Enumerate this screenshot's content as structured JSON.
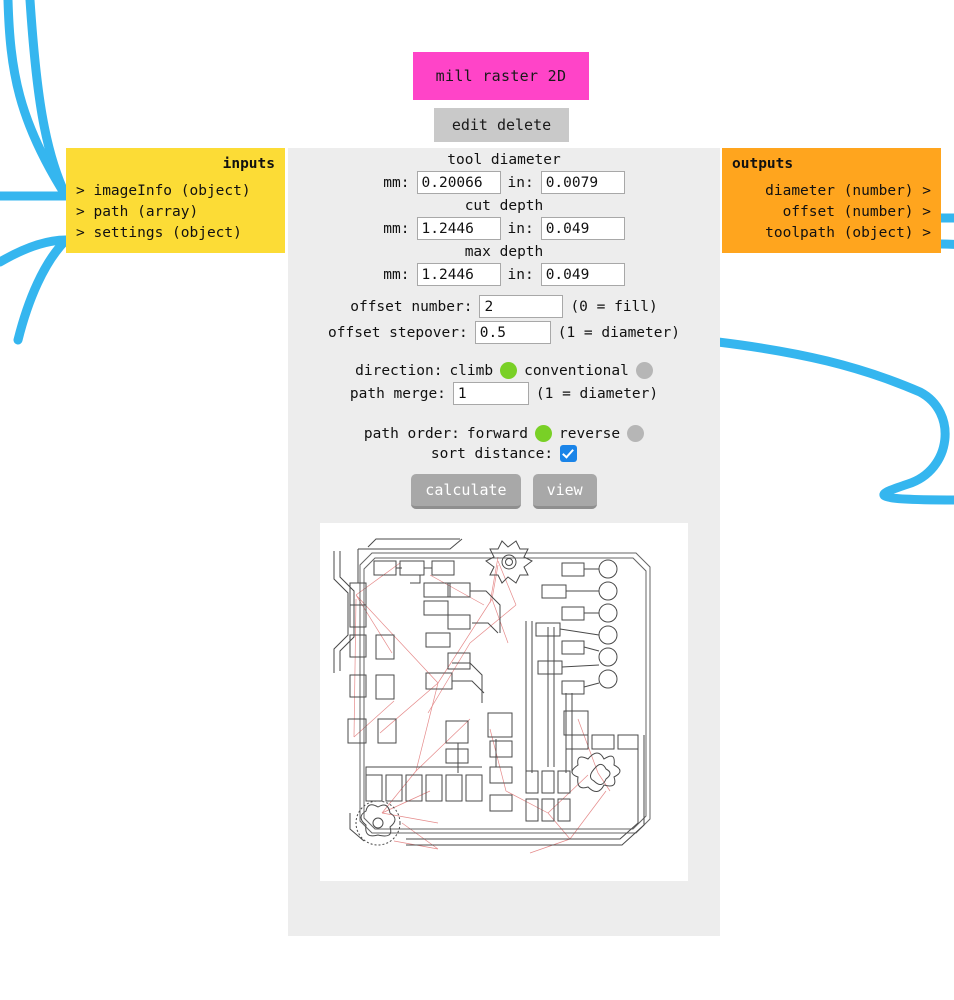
{
  "node": {
    "title": "mill raster 2D",
    "title_color": "#ff44c8",
    "menu": {
      "edit": "edit",
      "delete": "delete"
    }
  },
  "inputs": {
    "heading": "inputs",
    "panel_color": "#fcdc36",
    "items": [
      {
        "arrow": ">",
        "label": "imageInfo (object)"
      },
      {
        "arrow": ">",
        "label": "path (array)"
      },
      {
        "arrow": ">",
        "label": "settings (object)"
      }
    ]
  },
  "outputs": {
    "heading": "outputs",
    "panel_color": "#ffa51e",
    "items": [
      {
        "label": "diameter (number)",
        "arrow": ">"
      },
      {
        "label": "offset (number)",
        "arrow": ">"
      },
      {
        "label": "toolpath (object)",
        "arrow": ">"
      }
    ]
  },
  "form": {
    "tool_diameter": {
      "group_label": "tool diameter",
      "mm_label": "mm:",
      "mm_value": "0.20066",
      "in_label": "in:",
      "in_value": "0.0079"
    },
    "cut_depth": {
      "group_label": "cut depth",
      "mm_label": "mm:",
      "mm_value": "1.2446",
      "in_label": "in:",
      "in_value": "0.049"
    },
    "max_depth": {
      "group_label": "max depth",
      "mm_label": "mm:",
      "mm_value": "1.2446",
      "in_label": "in:",
      "in_value": "0.049"
    },
    "offset_number": {
      "label": "offset number:",
      "value": "2",
      "hint": "(0 = fill)"
    },
    "offset_stepover": {
      "label": "offset stepover:",
      "value": "0.5",
      "hint": "(1 = diameter)"
    },
    "direction": {
      "label": "direction:",
      "option_climb": "climb",
      "option_conventional": "conventional",
      "selected": "climb"
    },
    "path_merge": {
      "label": "path merge:",
      "value": "1",
      "hint": "(1 = diameter)"
    },
    "path_order": {
      "label": "path order:",
      "option_forward": "forward",
      "option_reverse": "reverse",
      "selected": "forward"
    },
    "sort_distance": {
      "label": "sort distance:",
      "checked": true
    },
    "buttons": {
      "calculate": "calculate",
      "view": "view"
    }
  },
  "preview": {
    "name": "toolpath-preview",
    "background": "#ffffff",
    "path_color": "#4a4a4a",
    "rapid_color": "#e58a8a"
  },
  "wires": {
    "color": "#35b6ef"
  }
}
